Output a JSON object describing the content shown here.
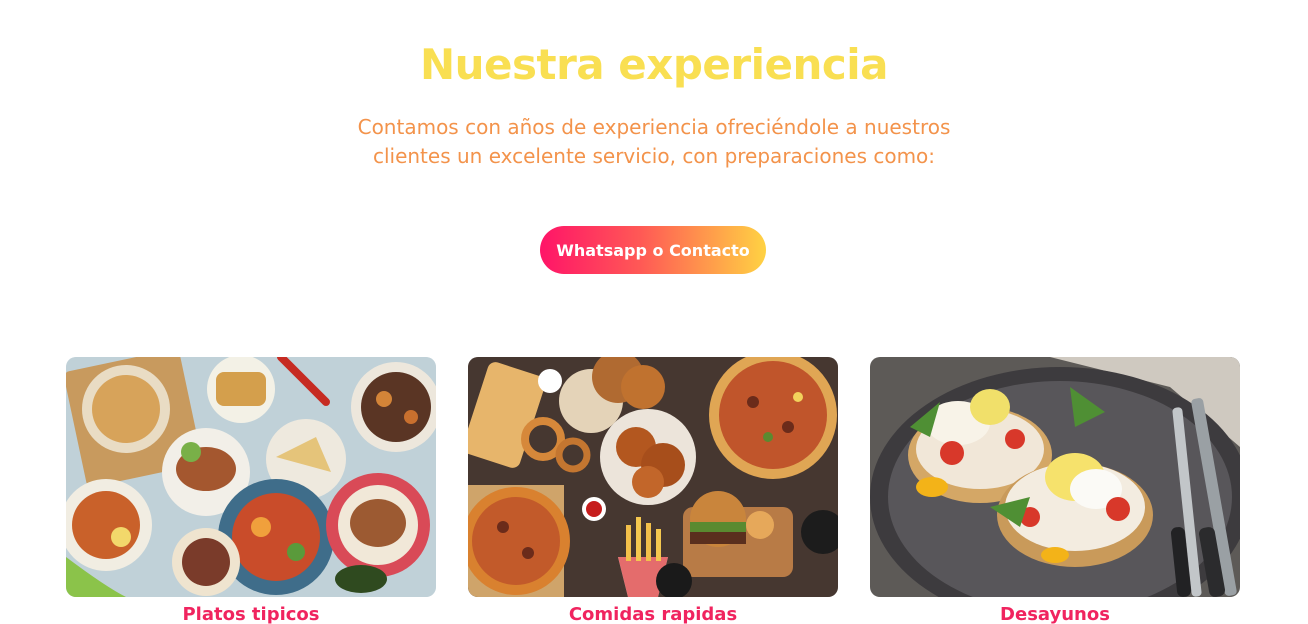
{
  "section": {
    "title": "Nuestra experiencia",
    "subtitle": "Contamos con años de experiencia ofreciéndole a nuestros clientes un excelente servicio, con preparaciones como:",
    "cta_label": "Whatsapp o Contacto"
  },
  "cards": [
    {
      "label": "Platos tipicos",
      "image": "table-of-traditional-dishes"
    },
    {
      "label": "Comidas rapidas",
      "image": "pizza-fried-chicken-burger-fries"
    },
    {
      "label": "Desayunos",
      "image": "eggs-benedict-on-plate"
    }
  ],
  "colors": {
    "title": "#f9df52",
    "subtitle": "#f3934b",
    "caption": "#f0245f",
    "cta_gradient_start": "#ff1468",
    "cta_gradient_end": "#ffd243"
  }
}
